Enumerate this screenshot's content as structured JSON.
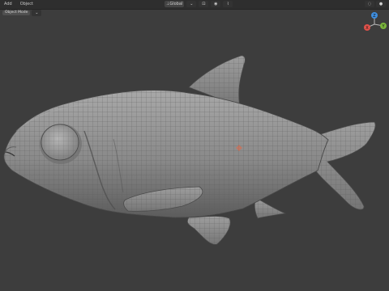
{
  "menu": {
    "items": [
      "Add",
      "Object"
    ]
  },
  "header": {
    "mode_selector": "Object Mode",
    "transform_label": "Global"
  },
  "gizmo": {
    "x_label": "X",
    "y_label": "Y",
    "z_label": "Z",
    "colors": {
      "x": "#e0514a",
      "y": "#7ab43c",
      "z": "#3f8fe0"
    }
  },
  "viewport": {
    "background": "#3d3d3d",
    "mesh_color": "#8a8a8a"
  }
}
